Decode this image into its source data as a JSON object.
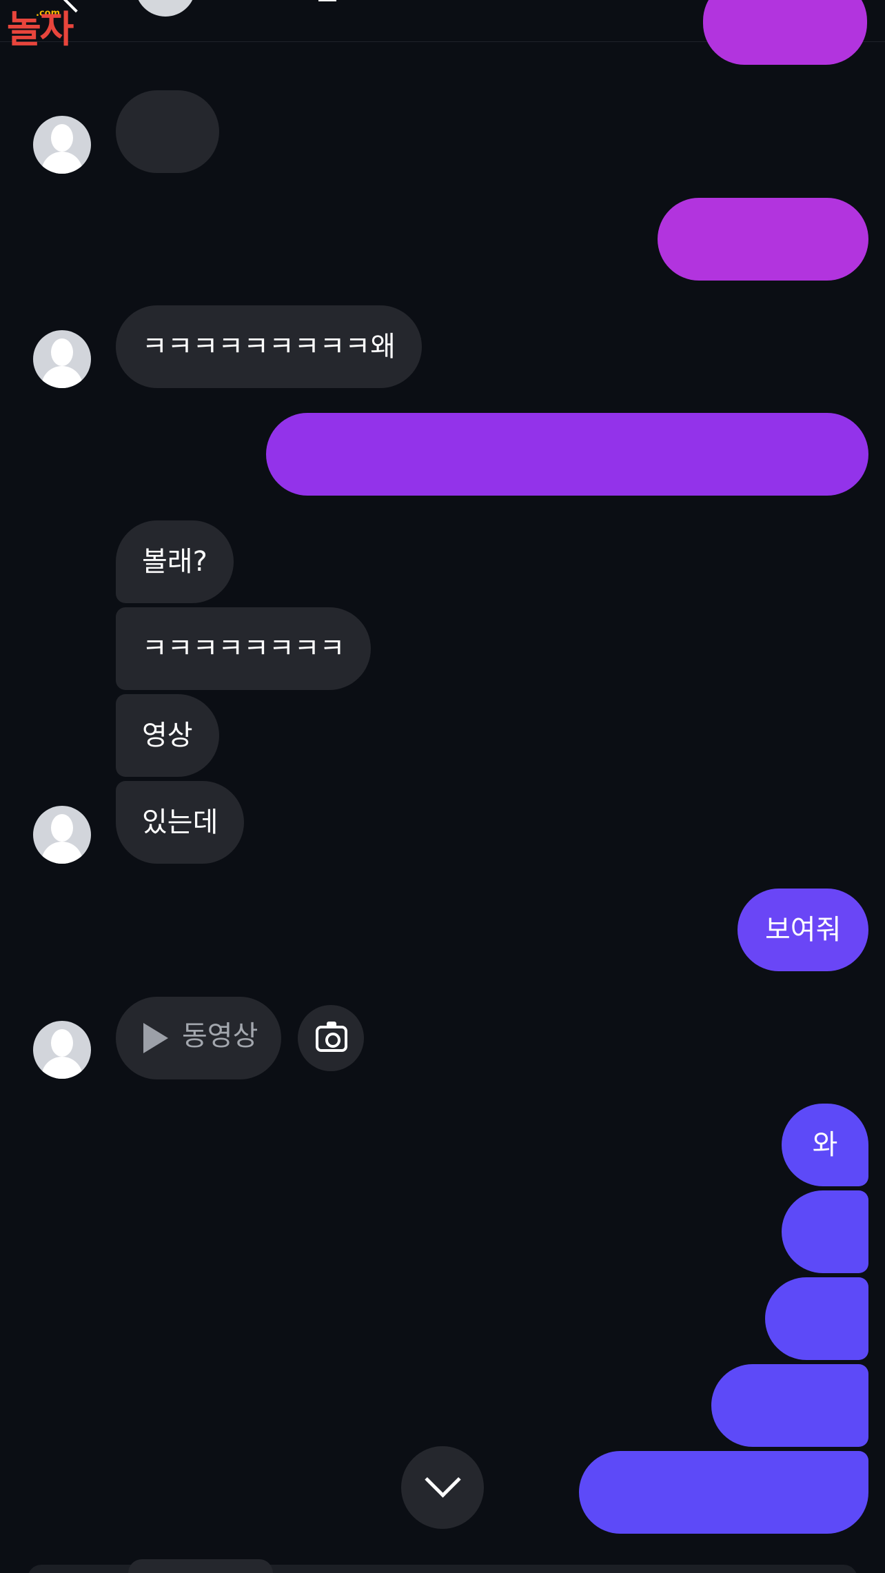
{
  "app": {
    "logo_text": "놀자",
    "logo_suffix": ".com"
  },
  "messages": {
    "recv_laugh_why": "ㅋㅋㅋㅋㅋㅋㅋㅋㅋ왜",
    "recv_want_see": "볼래?",
    "recv_laugh": "ㅋㅋㅋㅋㅋㅋㅋㅋ",
    "recv_video_word": "영상",
    "recv_have": "있는데",
    "sent_show_me": "보여줘",
    "recv_video_attachment": "동영상",
    "sent_wow": "와"
  },
  "colors": {
    "background": "#0b0e14",
    "received_bubble": "#25272d",
    "sent_pink": "#b234de",
    "sent_purple": "#9333ea",
    "sent_violet": "#6a46f6",
    "sent_blue": "#5d4af8",
    "logo": "#e8453c"
  },
  "icons": {
    "video_attachment": "play-icon",
    "camera_button": "camera-icon",
    "scroll_button": "chevron-down-icon"
  }
}
